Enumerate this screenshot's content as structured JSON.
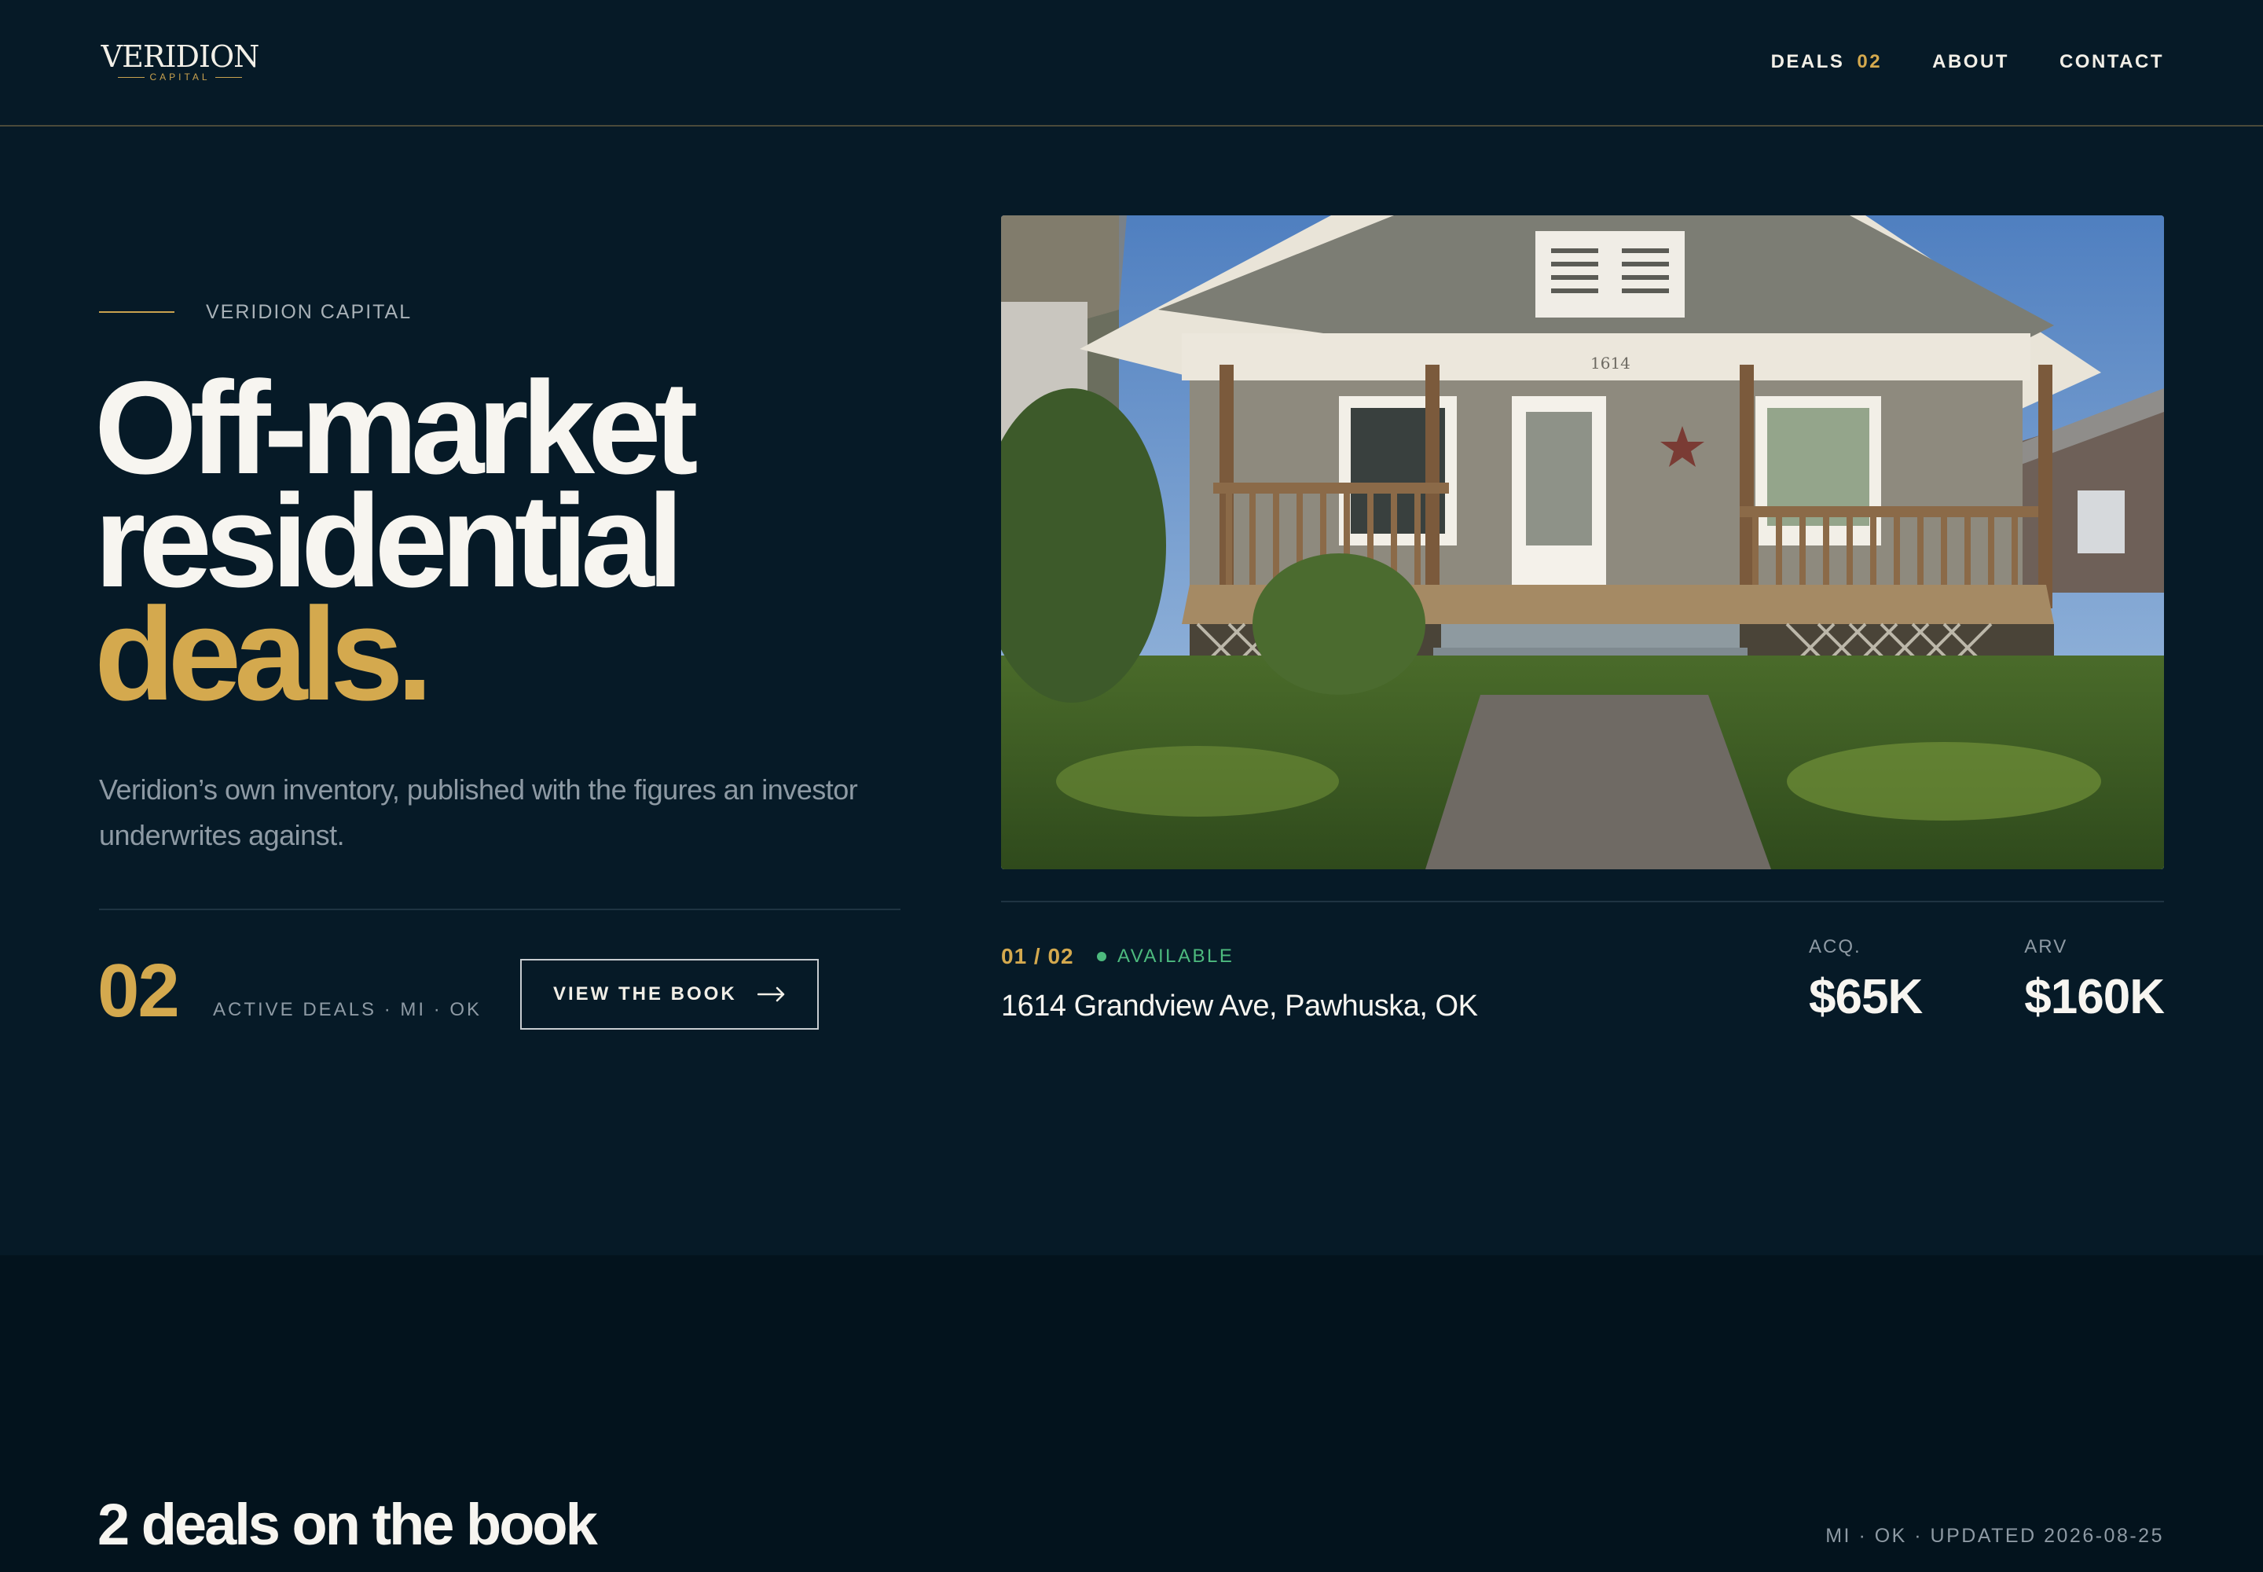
{
  "brand": {
    "logo_word": "VERIDION",
    "logo_sub": "CAPITAL"
  },
  "nav": {
    "deals_label": "DEALS",
    "deals_count": "02",
    "about_label": "ABOUT",
    "contact_label": "CONTACT"
  },
  "hero": {
    "eyebrow": "VERIDION CAPITAL",
    "headline_line1": "Off-market",
    "headline_line2": "residential",
    "headline_accent": "deals.",
    "lede": "Veridion’s own inventory, published with the figures an investor underwrites against.",
    "count": "02",
    "count_label": "ACTIVE DEALS · MI · OK",
    "cta_label": "VIEW THE BOOK"
  },
  "featured": {
    "index": "01 / 02",
    "status": "AVAILABLE",
    "address": "1614 Grandview Ave, Pawhuska, OK",
    "house_number": "1614",
    "acq_label": "ACQ.",
    "acq_value": "$65K",
    "arv_label": "ARV",
    "arv_value": "$160K"
  },
  "book": {
    "title": "2 deals on the book",
    "meta": "MI · OK · UPDATED 2026-08-25"
  },
  "colors": {
    "background": "#061a27",
    "accent_gold": "#d4a94e",
    "status_green": "#4dba7e",
    "section_dark": "#03131d"
  }
}
